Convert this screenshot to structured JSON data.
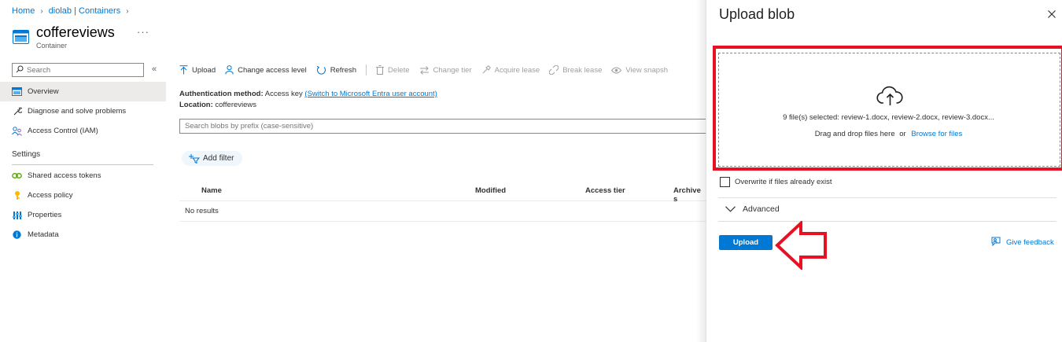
{
  "breadcrumb": {
    "home": "Home",
    "container": "diolab | Containers"
  },
  "resource": {
    "title": "coffereviews",
    "subtitle": "Container",
    "more": "···"
  },
  "nav": {
    "search_placeholder": "Search",
    "collapse": "«",
    "items": [
      {
        "label": "Overview",
        "icon": "container-icon"
      },
      {
        "label": "Diagnose and solve problems",
        "icon": "wrench-icon"
      },
      {
        "label": "Access Control (IAM)",
        "icon": "people-icon"
      }
    ],
    "settings_heading": "Settings",
    "settings_items": [
      {
        "label": "Shared access tokens",
        "icon": "link-icon"
      },
      {
        "label": "Access policy",
        "icon": "key-icon"
      },
      {
        "label": "Properties",
        "icon": "properties-icon"
      },
      {
        "label": "Metadata",
        "icon": "info-icon"
      }
    ]
  },
  "toolbar": {
    "upload": "Upload",
    "change_access_level": "Change access level",
    "refresh": "Refresh",
    "delete": "Delete",
    "change_tier": "Change tier",
    "acquire_lease": "Acquire lease",
    "break_lease": "Break lease",
    "view_snapshots": "View snapsh"
  },
  "auth": {
    "method_label": "Authentication method:",
    "method_value": "Access key",
    "switch_link": "(Switch to Microsoft Entra user account)",
    "location_label": "Location:",
    "location_value": "coffereviews"
  },
  "blob_search": {
    "placeholder": "Search blobs by prefix (case-sensitive)"
  },
  "add_filter": "Add filter",
  "grid": {
    "columns": [
      "Name",
      "Modified",
      "Access tier",
      "Archive s"
    ],
    "empty": "No results"
  },
  "panel": {
    "title": "Upload blob",
    "files_selected": "9 file(s) selected: review-1.docx, review-2.docx, review-3.docx...",
    "drag_text": "Drag and drop files here",
    "or": "or",
    "browse": "Browse for files",
    "overwrite": "Overwrite if files already exist",
    "advanced": "Advanced",
    "upload_button": "Upload",
    "feedback": "Give feedback"
  },
  "colors": {
    "accent": "#0078d4",
    "annotation": "#e81123"
  }
}
